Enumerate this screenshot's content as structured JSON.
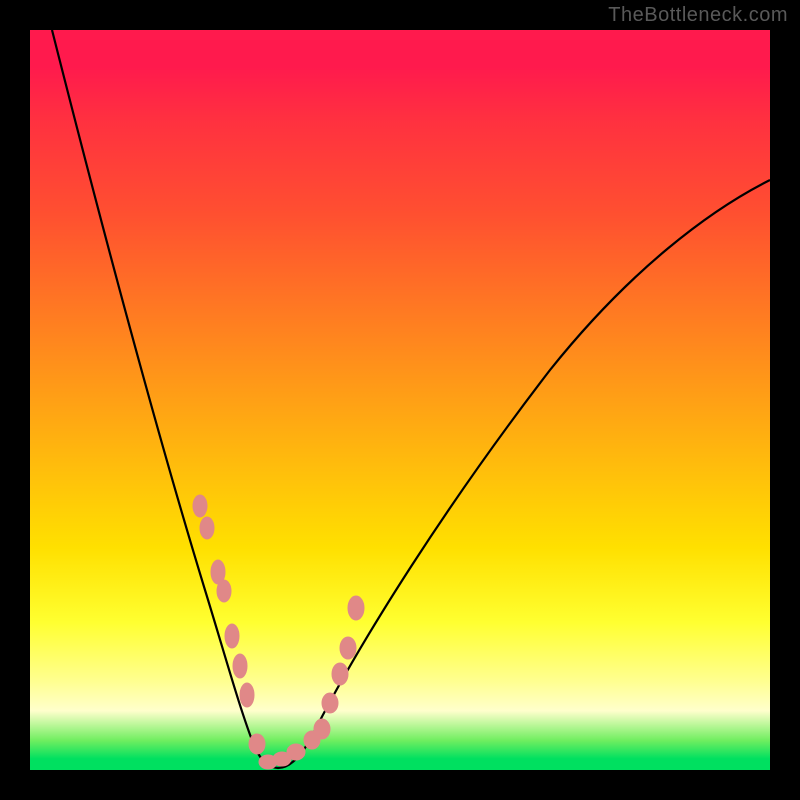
{
  "attribution": "TheBottleneck.com",
  "chart_data": {
    "type": "line",
    "title": "",
    "xlabel": "",
    "ylabel": "",
    "xlim": [
      0,
      100
    ],
    "ylim": [
      0,
      100
    ],
    "background_gradient": {
      "stops": [
        {
          "pct": 0,
          "color": "#ff1a4d"
        },
        {
          "pct": 25,
          "color": "#ff5030"
        },
        {
          "pct": 55,
          "color": "#ffb010"
        },
        {
          "pct": 80,
          "color": "#ffff30"
        },
        {
          "pct": 96,
          "color": "#70ee60"
        },
        {
          "pct": 100,
          "color": "#00e060"
        }
      ]
    },
    "series": [
      {
        "name": "bottleneck-curve",
        "stroke": "#000000",
        "x": [
          3,
          6,
          10,
          14,
          18,
          22,
          25,
          27,
          29,
          31,
          33,
          35,
          40,
          45,
          50,
          55,
          60,
          65,
          70,
          75,
          80,
          85,
          90,
          95,
          100
        ],
        "y": [
          100,
          88,
          76,
          64,
          52,
          38,
          27,
          18,
          10,
          4,
          1,
          1,
          5,
          12,
          22,
          32,
          41,
          49,
          56,
          62,
          67,
          71,
          75,
          78,
          80
        ]
      },
      {
        "name": "marker-points",
        "stroke": "#e08080",
        "style": "points",
        "x": [
          22.5,
          23.5,
          25.0,
          25.8,
          27.0,
          28.0,
          29.0,
          30.5,
          32.0,
          34.0,
          36.0,
          38.0,
          39.5,
          40.5,
          42.0,
          43.0,
          44.0
        ],
        "y": [
          36.0,
          33.0,
          27.0,
          24.5,
          18.0,
          14.0,
          10.0,
          3.5,
          1.0,
          1.5,
          2.5,
          4.0,
          5.5,
          9.0,
          13.0,
          16.5,
          22.0
        ]
      }
    ]
  }
}
